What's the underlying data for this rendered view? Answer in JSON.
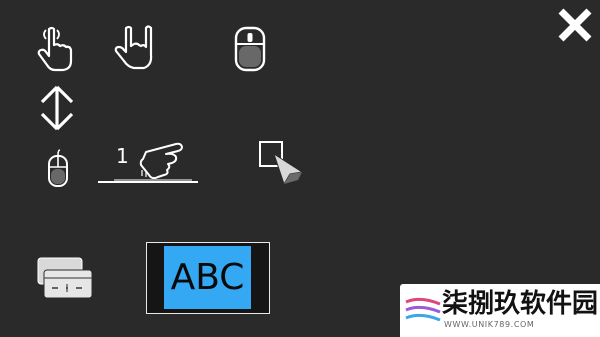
{
  "toolbar": {
    "close_icon": "close-icon",
    "row1": [
      "tap-gesture-icon",
      "rock-gesture-icon",
      "mouse-icon"
    ],
    "row2": [
      "vertical-scroll-icon"
    ],
    "row3": [
      "small-mouse-icon",
      "one-finger-swipe-icon",
      "cursor-pointer-icon"
    ],
    "row4": [
      "keyboard-icon",
      "abc-keyboard-button"
    ]
  },
  "gesture": {
    "finger_count": "1"
  },
  "keyboard": {
    "abc_label": "ABC"
  },
  "watermark": {
    "title": "柒捌玖软件园",
    "url": "WWW.UNIK789.COM"
  },
  "colors": {
    "background": "#2a2a2a",
    "icon": "#ffffff",
    "accent": "#35a8f4"
  }
}
